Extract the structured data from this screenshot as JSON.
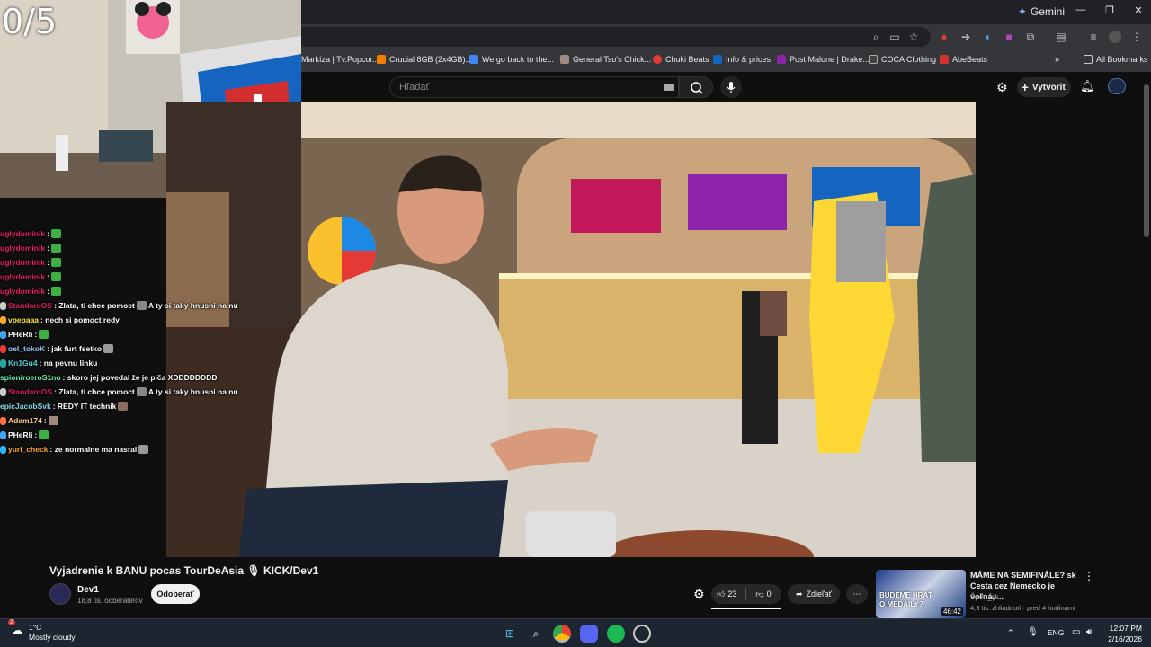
{
  "stream_overlay": {
    "counter": "0/5"
  },
  "chrome": {
    "gemini_label": "Gemini",
    "window_controls": [
      "—",
      "❐",
      "✕"
    ],
    "bookmarks": [
      {
        "label": "Markíza | Tv.Popcor...",
        "color": "#e0e0e0"
      },
      {
        "label": "Crucial 8GB (2x4GB)...",
        "color": "#f57c00"
      },
      {
        "label": "We go back to the...",
        "color": "#4285f4"
      },
      {
        "label": "General Tso's Chick...",
        "color": "#a1887f"
      },
      {
        "label": "Chuki Beats",
        "color": "#e53935"
      },
      {
        "label": "Info & prices",
        "color": "#1565c0"
      },
      {
        "label": "Post Malone | Drake...",
        "color": "#8e24aa"
      },
      {
        "label": "COCA Clothing",
        "color": "#424242"
      },
      {
        "label": "AbeBeats",
        "color": "#d32f2f"
      }
    ],
    "all_bookmarks": "All Bookmarks"
  },
  "youtube_header": {
    "search_placeholder": "Hľadať",
    "create_label": "Vytvoriť"
  },
  "chat": [
    {
      "user": "uglydominik",
      "color": "#e91e63",
      "text": "",
      "emote": "#3cb043",
      "badge": ""
    },
    {
      "user": "uglydominik",
      "color": "#e91e63",
      "text": "",
      "emote": "#3cb043",
      "badge": ""
    },
    {
      "user": "uglydominik",
      "color": "#e91e63",
      "text": "",
      "emote": "#3cb043",
      "badge": ""
    },
    {
      "user": "uglydominik",
      "color": "#e91e63",
      "text": "",
      "emote": "#3cb043",
      "badge": ""
    },
    {
      "user": "uglydominik",
      "color": "#e91e63",
      "text": "",
      "emote": "#3cb043",
      "badge": ""
    },
    {
      "user": "StandardOS",
      "color": "#d81b60",
      "text": ": Zlata, ti chce pomoct",
      "emote": "#888888",
      "after": "A ty si taky hnusni na nu",
      "badge": "#cccccc"
    },
    {
      "user": "vpepaaa",
      "color": "#ffeb3b",
      "text": ": nech si pomoct redy",
      "emote": "",
      "badge": "#f9a825"
    },
    {
      "user": "PHeRli",
      "color": "#ffffff",
      "text": ":",
      "emote": "#3cb043",
      "badge": "#42a5f5"
    },
    {
      "user": "oel_tokoK",
      "color": "#90caf9",
      "text": ": jak furt fsetko",
      "emote": "#999999",
      "badge": "#e53935"
    },
    {
      "user": "Kn1Gu4",
      "color": "#4dd0e1",
      "text": ": na pevnu linku",
      "emote": "",
      "badge": "#26a69a"
    },
    {
      "user": "spioniroeroS1no",
      "color": "#69f0ae",
      "text": ": skoro jej povedal že je piča XDDDDDDDD",
      "emote": "",
      "badge": ""
    },
    {
      "user": "StandardOS",
      "color": "#d81b60",
      "text": ": Zlata, ti chce pomoct",
      "emote": "#888888",
      "after": "A ty si taky hnusni na nu",
      "badge": "#cccccc"
    },
    {
      "user": "epicJacobSvk",
      "color": "#80deea",
      "text": ": REDY IT technik",
      "emote": "#8d6e63",
      "badge": ""
    },
    {
      "user": "Adam174",
      "color": "#ffcc80",
      "text": ":",
      "emote": "#a1887f",
      "badge": "#ff7043"
    },
    {
      "user": "PHeRli",
      "color": "#ffffff",
      "text": ":",
      "emote": "#3cb043",
      "badge": "#42a5f5"
    },
    {
      "user": "yuri_check",
      "color": "#ffa726",
      "text": ": ze normalne ma nasral",
      "emote": "#999999",
      "badge": "#29b6f6"
    }
  ],
  "video_info": {
    "title": "Vyjadrenie k BANU pocas TourDeAsia 🎙 KICK/Dev1",
    "channel": "Dev1",
    "subscribers": "18,8 tis. odberateľov",
    "subscribe_label": "Odoberať",
    "likes": "23",
    "dislikes": "0",
    "share_label": "Zdieľať"
  },
  "recommended": {
    "title": "MÁME NA SEMIFINÁLE? sk Cesta cez Nemecko je voľná, ...",
    "channel": "Šport_sk",
    "meta": "4,3 tis. zhliadnutí · pred 4 hodinami",
    "duration": "46:42",
    "thumb_text": "BUDEME HRAŤ O MEDAILY?"
  },
  "taskbar": {
    "weather_temp": "1°C",
    "weather_desc": "Mostly cloudy",
    "weather_badge": "2",
    "language": "ENG",
    "time": "12:07 PM",
    "date": "2/16/2026"
  }
}
